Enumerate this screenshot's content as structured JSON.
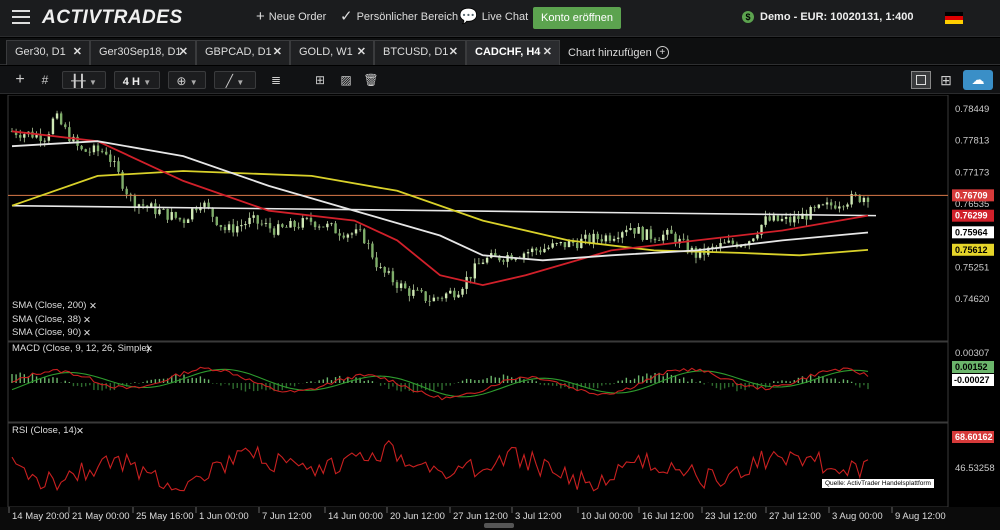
{
  "app": {
    "logo": "ACTIVTRADES",
    "new_order": "Neue Order",
    "personal_area": "Persönlicher Bereich",
    "live_chat": "Live Chat",
    "open_account": "Konto eröffnen",
    "account": "Demo - EUR: 10020131, 1:400",
    "language_flag": "de-flag-icon"
  },
  "tabs": [
    {
      "label": "Ger30, D1"
    },
    {
      "label": "Ger30Sep18, D1"
    },
    {
      "label": "GBPCAD, D1"
    },
    {
      "label": "GOLD, W1"
    },
    {
      "label": "BTCUSD, D1"
    },
    {
      "label": "CADCHF, H4",
      "active": true
    }
  ],
  "add_chart": "Chart hinzufügen",
  "toolbar": {
    "timeframe": "4 H"
  },
  "chart": {
    "symbol": "CADCHF",
    "timeframe": "H4",
    "price_axis": [
      "0.78449",
      "0.77813",
      "0.77173",
      "0.76535",
      "0.75251",
      "0.74620"
    ],
    "price_tags": {
      "current": "0.76709",
      "sma_38": "0.76299",
      "sma_90": "0.75964",
      "sma_200": "0.75612"
    },
    "colors": {
      "candles": "#cfe8b5",
      "sma_200": "#d9d12a",
      "sma_38": "#d1202a",
      "sma_90": "#e6e6e6",
      "trendline": "#e8e8e8",
      "price_line": "#d97a4a",
      "macd": "#c92020",
      "signal": "#2e9b2e",
      "rsi": "#c92020"
    },
    "indicator_legends": [
      "SMA (Close, 200)",
      "SMA (Close, 38)",
      "SMA (Close, 90)"
    ],
    "macd": {
      "legend": "MACD (Close, 9, 12, 26, Simple)",
      "axis": [
        "0.00307"
      ],
      "tags": {
        "signal": "0.00152",
        "macd": "-0.00027"
      }
    },
    "rsi": {
      "legend": "RSI (Close, 14)",
      "axis": [
        "46.53258"
      ],
      "tag": "68.60162"
    },
    "x_axis": [
      "14 May 20:00",
      "21 May 00:00",
      "25 May 16:00",
      "1 Jun 00:00",
      "7 Jun 12:00",
      "14 Jun 00:00",
      "20 Jun 12:00",
      "27 Jun 12:00",
      "3 Jul 12:00",
      "10 Jul 00:00",
      "16 Jul 12:00",
      "23 Jul 12:00",
      "27 Jul 12:00",
      "3 Aug 00:00",
      "9 Aug 12:00"
    ],
    "source": "Quelle: ActivTrader Handelsplattform"
  }
}
